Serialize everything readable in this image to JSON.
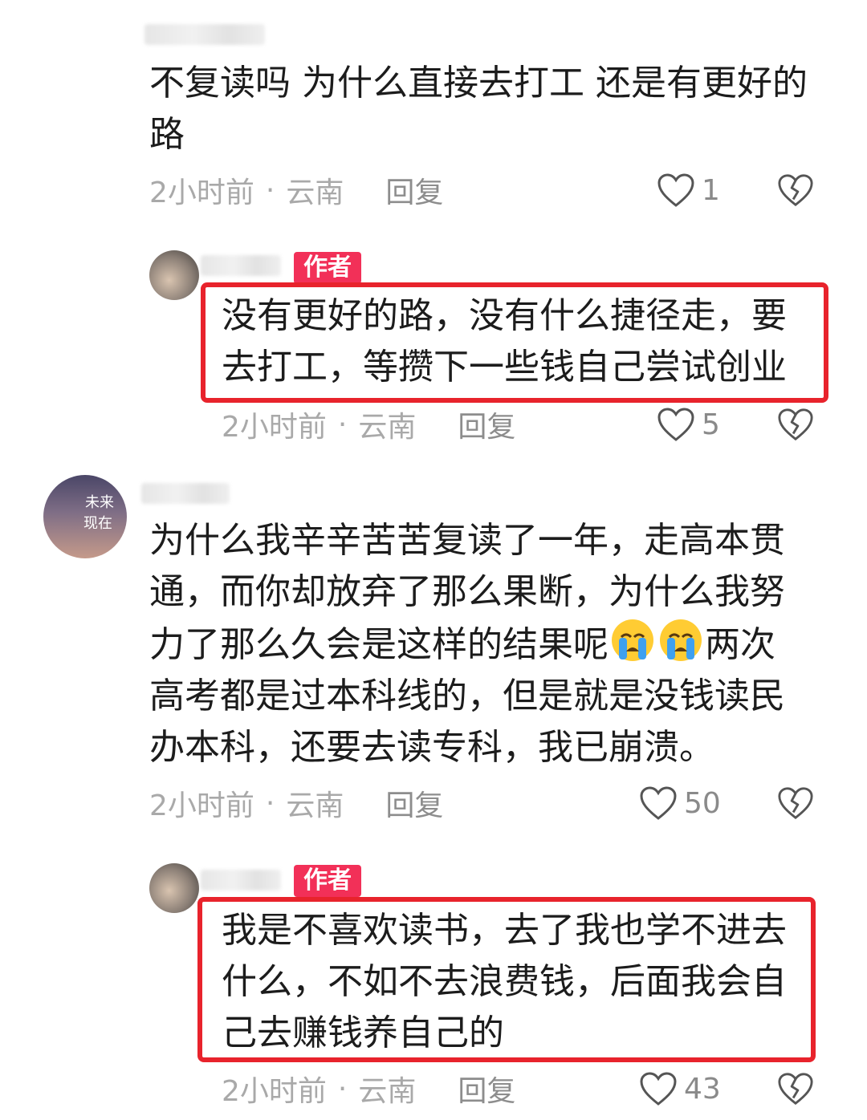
{
  "comments": [
    {
      "text": "不复读吗 为什么直接去打工 还是有更好的路",
      "time": "2小时前",
      "location": "云南",
      "reply_label": "回复",
      "likes": "1"
    },
    {
      "badge": "作者",
      "text": "没有更好的路，没有什么捷径走，要去打工，等攒下一些钱自己尝试创业",
      "time": "2小时前",
      "location": "云南",
      "reply_label": "回复",
      "likes": "5"
    },
    {
      "avatar_text_1": "未来",
      "avatar_text_2": "现在",
      "text_part1": "为什么我辛辛苦苦复读了一年，走高本贯通，而你却放弃了那么果断，为什么我努力了那么久会是这样的结果呢",
      "text_part2": "两次高考都是过本科线的，但是就是没钱读民办本科，还要去读专科，我已崩溃。",
      "time": "2小时前",
      "location": "云南",
      "reply_label": "回复",
      "likes": "50"
    },
    {
      "badge": "作者",
      "text": "我是不喜欢读书，去了我也学不进去什么，不如不去浪费钱，后面我会自己去赚钱养自己的",
      "time": "2小时前",
      "location": "云南",
      "reply_label": "回复",
      "likes": "43"
    }
  ],
  "meta_separator": "·",
  "colors": {
    "badge": "#f23058",
    "highlight_box": "#e8232c",
    "meta": "#a9a9a9"
  }
}
